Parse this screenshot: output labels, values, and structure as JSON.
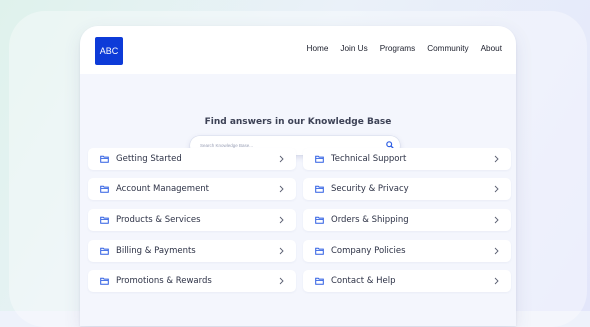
{
  "header": {
    "logo_text": "ABC",
    "nav": [
      "Home",
      "Join Us",
      "Programs",
      "Community",
      "About"
    ]
  },
  "hero": {
    "title": "Find answers in our Knowledge Base",
    "search_placeholder": "Search Knowledge Base..."
  },
  "categories": [
    "Getting Started",
    "Technical Support",
    "Account Management",
    "Security & Privacy",
    "Products & Services",
    "Orders & Shipping",
    "Billing & Payments",
    "Company Policies",
    "Promotions & Rewards",
    "Contact & Help"
  ],
  "icons": {
    "logo": "abc-logo",
    "search": "search-icon",
    "category": "folder-icon",
    "chevron": "chevron-right-icon"
  },
  "colors": {
    "brand": "#0d3bd8",
    "accent_icon": "#2f5fe3",
    "page_bg": "#f4f6fd"
  }
}
